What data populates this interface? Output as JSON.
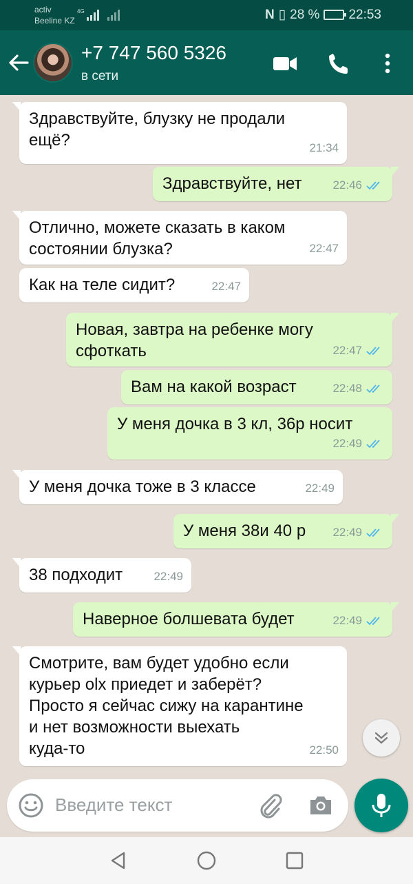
{
  "statusbar": {
    "carrier_line1": "activ",
    "carrier_line2": "Beeline KZ",
    "network": "4G",
    "nfc": "N",
    "battery": "28 %",
    "time": "22:53"
  },
  "header": {
    "contact_name": "+7 747 560 5326",
    "contact_status": "в сети"
  },
  "messages": [
    {
      "dir": "in",
      "text": "Здравствуйте, блузку не продали\nещё?",
      "time": "21:34"
    },
    {
      "dir": "out",
      "text": "Здравствуйте, нет",
      "time": "22:46",
      "read": true
    },
    {
      "dir": "in",
      "text": "Отлично, можете сказать в каком\nсостоянии блузка?",
      "time": "22:47"
    },
    {
      "dir": "in",
      "text": "Как на теле сидит?",
      "time": "22:47"
    },
    {
      "dir": "out",
      "text": "Новая, завтра на ребенке могу\nсфоткать",
      "time": "22:47",
      "read": true
    },
    {
      "dir": "out",
      "text": "Вам на какой возраст",
      "time": "22:48",
      "read": true
    },
    {
      "dir": "out",
      "text": "У меня дочка в 3 кл, 36р носит",
      "time": "22:49",
      "read": true
    },
    {
      "dir": "in",
      "text": "У меня дочка тоже в 3 классе",
      "time": "22:49"
    },
    {
      "dir": "out",
      "text": "У меня 38и 40 р",
      "time": "22:49",
      "read": true
    },
    {
      "dir": "in",
      "text": "38 подходит",
      "time": "22:49"
    },
    {
      "dir": "out",
      "text": "Наверное болшевата будет",
      "time": "22:49",
      "read": true
    },
    {
      "dir": "in",
      "text": "Смотрите, вам будет удобно если\nкурьер olx приедет и заберёт?\nПросто я сейчас сижу на карантине\nи нет возможности выехать\nкуда-то",
      "time": "22:50"
    }
  ],
  "input": {
    "placeholder": "Введите текст"
  },
  "colors": {
    "header": "#075e54",
    "statusbar": "#054d44",
    "chat_bg": "#e5ddd5",
    "outgoing": "#dcf8c6",
    "incoming": "#ffffff",
    "read_ticks": "#4fb6ec",
    "mic": "#00897b"
  },
  "icons": [
    "back-arrow-icon",
    "video-call-icon",
    "phone-icon",
    "more-vert-icon",
    "double-check-icon",
    "chevron-down-icon",
    "emoji-icon",
    "attach-icon",
    "camera-icon",
    "mic-icon",
    "nav-back-icon",
    "nav-home-icon",
    "nav-recents-icon"
  ]
}
